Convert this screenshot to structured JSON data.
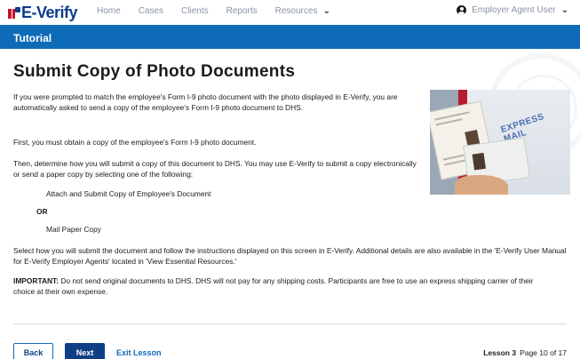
{
  "nav": {
    "logo_text": "E-Verify",
    "links": [
      "Home",
      "Cases",
      "Clients",
      "Reports",
      "Resources"
    ],
    "user_label": "Employer Agent User"
  },
  "banner": {
    "title": "Tutorial"
  },
  "page": {
    "heading": "Submit Copy of Photo Documents",
    "p1": "If you were prompted to match the employee's Form I-9 photo document with the photo displayed in E-Verify, you are automatically asked to send a copy of the employee's Form I-9 photo document to DHS.",
    "p2": "First, you must obtain a copy of the employee's Form I-9 photo document.",
    "p3": "Then, determine how you will submit a copy of this document to DHS. You may use E-Verify to submit a copy electronically or send a paper copy by selecting one of the following:",
    "option1": "Attach and Submit Copy of Employee's Document",
    "or_label": "OR",
    "option2": "Mail Paper Copy",
    "p4": "Select how you will submit the document and follow the instructions displayed on this screen in E-Verify. Additional details are also available in the 'E-Verify User Manual for E-Verify Employer Agents' located in 'View Essential Resources.'",
    "important_label": "IMPORTANT:",
    "important_text": " Do not send original documents to DHS. DHS will not pay for any shipping costs. Participants are free to use an express shipping carrier of their choice at their own expense.",
    "image_stamp": "EXPRESS MAIL"
  },
  "footer": {
    "back_label": "Back",
    "next_label": "Next",
    "exit_label": "Exit Lesson",
    "lesson_label": "Lesson 3",
    "page_label": "Page 10 of 17"
  },
  "colors": {
    "brand_blue": "#0e6bb8",
    "dark_blue": "#0e3f86",
    "flag_red": "#c8102e"
  },
  "icons": [
    "user-icon",
    "chevron-down-icon",
    "seal-watermark"
  ]
}
